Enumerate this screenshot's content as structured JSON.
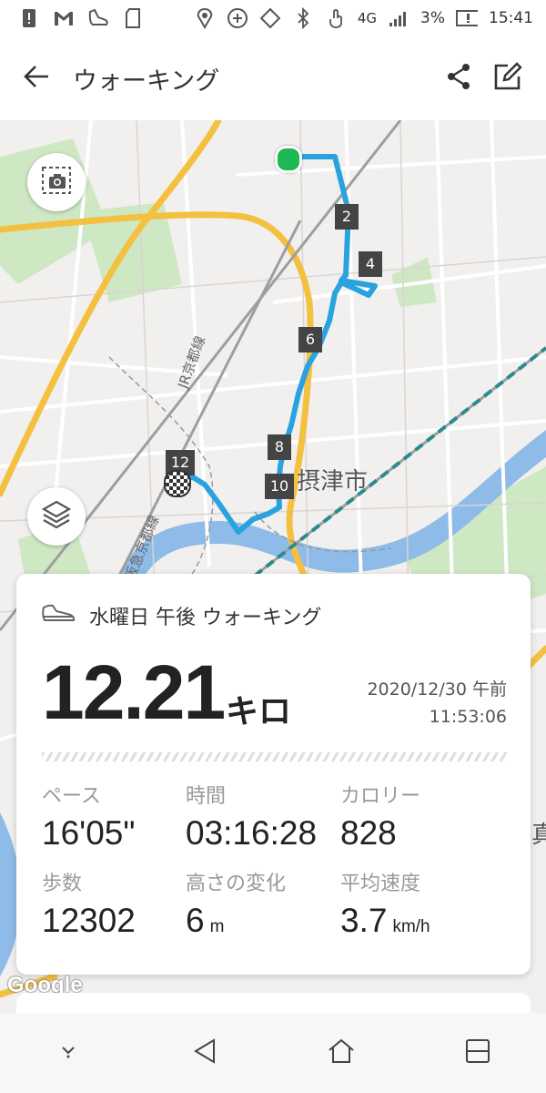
{
  "status": {
    "network": "4G",
    "battery": "3%",
    "time": "15:41"
  },
  "header": {
    "title": "ウォーキング"
  },
  "map": {
    "city_label": "摂津市",
    "rail_label_1": "JR京都線",
    "rail_label_2": "阪急京都線",
    "km_markers": [
      "2",
      "4",
      "6",
      "8",
      "10",
      "12"
    ],
    "right_label": "真",
    "attribution": "Google",
    "route_color": "#29a3e0",
    "start_color": "#1db954"
  },
  "summary": {
    "activity_title": "水曜日 午後 ウォーキング",
    "distance_value": "12.21",
    "distance_unit": "キロ",
    "date": "2020/12/30 午前",
    "time": "11:53:06"
  },
  "stats": [
    {
      "label": "ペース",
      "value": "16'05\"",
      "unit": ""
    },
    {
      "label": "時間",
      "value": "03:16:28",
      "unit": ""
    },
    {
      "label": "カロリー",
      "value": "828",
      "unit": ""
    },
    {
      "label": "歩数",
      "value": "12302",
      "unit": ""
    },
    {
      "label": "高さの変化",
      "value": "6",
      "unit": "m"
    },
    {
      "label": "平均速度",
      "value": "3.7",
      "unit": "km/h"
    }
  ]
}
